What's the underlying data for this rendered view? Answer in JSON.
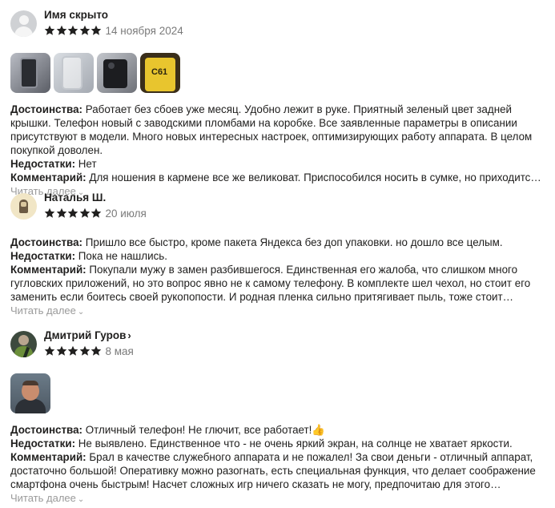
{
  "reviews": [
    {
      "author": "Имя скрыто",
      "rating": 5,
      "date": "14 ноября 2024",
      "photos": [
        "phone-photo",
        "phone-case-photo",
        "phone-back-photo",
        "phone-box-photo"
      ],
      "box_text": "C61",
      "pros_label": "Достоинства:",
      "pros": "Работает без сбоев уже месяц. Удобно лежит в руке. Приятный зеленый цвет задней крышки. Телефон новый с заводскими пломбами на коробке. Все заявленные параметры в описании присутствуют в модели. Много новых интересных настроек, оптимизирующих работу аппарата. В целом покупкой доволен.",
      "cons_label": "Недостатки:",
      "cons": "Нет",
      "comment_label": "Комментарий:",
      "comment": "Для ношения в кармене все же великоват. Приспособился носить в сумке, но приходится…",
      "read_more": "Читать далее"
    },
    {
      "author": "Наталья Ш.",
      "rating": 5,
      "date": "20 июля",
      "pros_label": "Достоинства:",
      "pros": "Пришло все быстро, кроме пакета Яндекса без доп упаковки. но дошло все целым.",
      "cons_label": "Недостатки:",
      "cons": "Пока не нашлись.",
      "comment_label": "Комментарий:",
      "comment": "Покупали мужу в замен разбившегося. Единственная его жалоба, что слишком много гугловских приложений, но это вопрос явно не к самому телефону. В комплекте шел чехол, но стоит его заменить если боитесь своей рукопопости. И родная пленка сильно притягивает пыль, тоже стоит заменить…",
      "read_more": "Читать далее"
    },
    {
      "author": "Дмитрий Гуров",
      "author_chevron": "›",
      "rating": 5,
      "date": "8 мая",
      "photos": [
        "selfie-photo"
      ],
      "pros_label": "Достоинства:",
      "pros": "Отличный телефон! Не глючит, все работает!👍",
      "cons_label": "Недостатки:",
      "cons": "Не выявлено. Единственное что - не очень яркий экран, на солнце не хватает яркости.",
      "comment_label": "Комментарий:",
      "comment": "Брал в качестве служебного аппарата и не пожалел! За свои деньги - отличный аппарат, достаточно большой! Оперативку можно разогнать, есть специальная функция, что делает соображение смартфона очень быстрым! Насчет сложных игр ничего сказать не могу, предпочитаю для этого компьютер…",
      "read_more": "Читать далее"
    }
  ],
  "colors": {
    "star": "#21201f",
    "date": "#7a7a7a",
    "read_more": "#9a9a9a",
    "text": "#21201f"
  },
  "icons": {
    "star": "star-icon",
    "chevron": "chevron-down-icon",
    "avatar_placeholder": "user-placeholder-icon"
  }
}
